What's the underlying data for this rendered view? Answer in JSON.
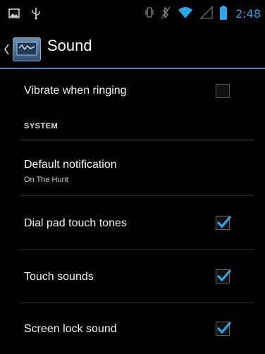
{
  "status_bar": {
    "time": "2:48",
    "time_color": "#29a7e6",
    "left_icons": [
      "gallery-notification-icon",
      "usb-icon"
    ],
    "right_icons": [
      "vibrate-mode-icon",
      "bluetooth-off-icon",
      "wifi-icon",
      "cell-signal-icon",
      "battery-icon"
    ]
  },
  "action_bar": {
    "title": "Sound",
    "accent_color": "#2e86c1"
  },
  "settings": {
    "vibrate": {
      "title": "Vibrate when ringing",
      "checked": false
    },
    "section_system": "SYSTEM",
    "default_notification": {
      "title": "Default notification",
      "summary": "On The Hunt"
    },
    "dial_pad": {
      "title": "Dial pad touch tones",
      "checked": true
    },
    "touch_sounds": {
      "title": "Touch sounds",
      "checked": true
    },
    "screen_lock": {
      "title": "Screen lock sound",
      "checked": true
    }
  }
}
